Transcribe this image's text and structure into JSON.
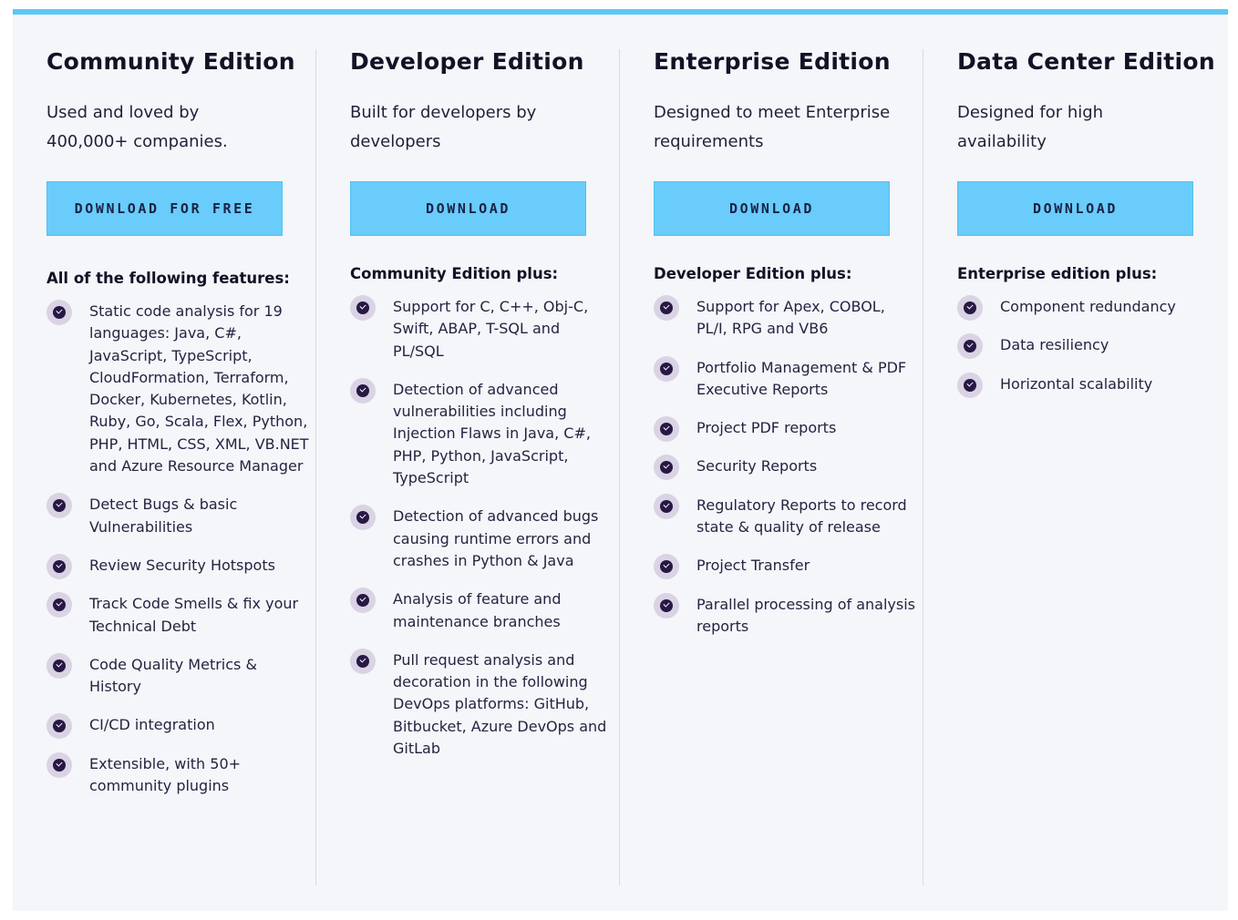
{
  "accent_color": "#5ac8f5",
  "button_color": "#69ccfb",
  "check_icon": "check-circle-icon",
  "editions": [
    {
      "title": "Community Edition",
      "description": "Used and loved by 400,000+ companies.",
      "button_label": "DOWNLOAD FOR FREE",
      "features_title": "All of the following features:",
      "features": [
        "Static code analysis for 19 languages: Java, C#, JavaScript, TypeScript, CloudFormation, Terraform, Docker, Kubernetes, Kotlin, Ruby, Go, Scala, Flex, Python, PHP, HTML, CSS, XML, VB.NET and Azure Resource Manager",
        "Detect Bugs & basic Vulnerabilities",
        "Review Security Hotspots",
        "Track Code Smells & fix your Technical Debt",
        "Code Quality Metrics & History",
        "CI/CD integration",
        "Extensible, with 50+ community plugins"
      ]
    },
    {
      "title": "Developer Edition",
      "description": "Built for developers by developers",
      "button_label": "DOWNLOAD",
      "features_title": "Community Edition plus:",
      "features": [
        "Support for C, C++, Obj-C, Swift, ABAP, T-SQL and PL/SQL",
        "Detection of advanced vulnerabilities including Injection Flaws in Java, C#, PHP, Python, JavaScript, TypeScript",
        "Detection of advanced bugs causing runtime errors and crashes in Python & Java",
        "Analysis of feature and maintenance branches",
        "Pull request analysis and decoration in the following DevOps platforms: GitHub, Bitbucket, Azure DevOps and GitLab"
      ]
    },
    {
      "title": "Enterprise Edition",
      "description": "Designed to meet Enterprise requirements",
      "button_label": "DOWNLOAD",
      "features_title": "Developer Edition plus:",
      "features": [
        "Support for Apex, COBOL, PL/I, RPG and VB6",
        "Portfolio Management & PDF Executive Reports",
        "Project PDF reports",
        "Security Reports",
        "Regulatory Reports to record state & quality of release",
        "Project Transfer",
        "Parallel processing of analysis reports"
      ]
    },
    {
      "title": "Data Center Edition",
      "description": "Designed for high availability",
      "button_label": "DOWNLOAD",
      "features_title": "Enterprise edition plus:",
      "features": [
        "Component redundancy",
        "Data resiliency",
        "Horizontal scalability"
      ]
    }
  ]
}
